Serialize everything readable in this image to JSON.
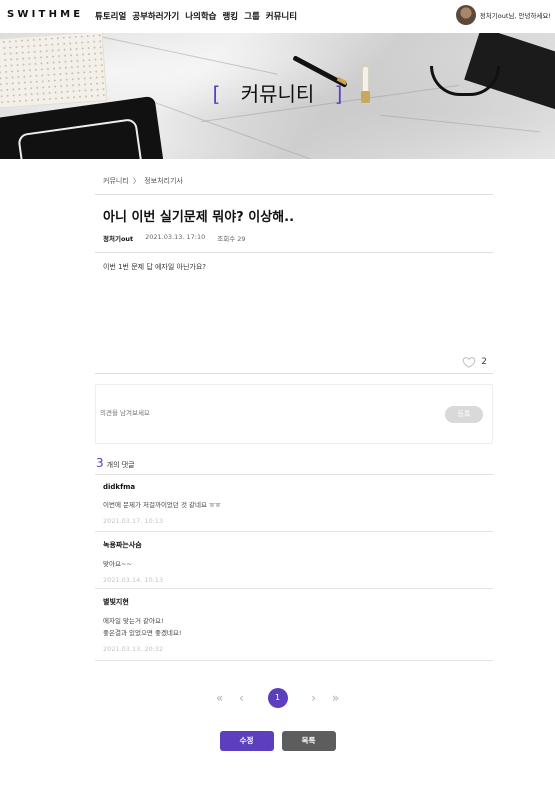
{
  "header": {
    "logo": "SWITHME",
    "nav": [
      "튜토리얼",
      "공부하러가기",
      "나의학습",
      "랭킹",
      "그룹",
      "커뮤니티"
    ],
    "greeting": "정처기out님, 안녕하세요!"
  },
  "banner": {
    "title": "커뮤니티",
    "bracket_open": "[",
    "bracket_close": "]"
  },
  "breadcrumb": {
    "root": "커뮤니티",
    "separator": "〉",
    "current": "정보처리기사"
  },
  "post": {
    "title": "아니 이번 실기문제 뭐야? 이상해..",
    "author": "정처기out",
    "date": "2021.03.13. 17:10",
    "views": "조회수 29",
    "body": "이번 1번 문제 답 에자일 아닌가요?",
    "likes": "2"
  },
  "comment_form": {
    "placeholder": "의견을 남겨보세요",
    "submit_label": "등록"
  },
  "comments_header": {
    "count": "3",
    "label": "개의 댓글"
  },
  "comments": [
    {
      "author": "didkfma",
      "lines": [
        "이번에 문제가 저걸까이었던 것 같네요 ㅠㅠ"
      ],
      "date": "2021.03.17. 10:13"
    },
    {
      "author": "녹용짜는사슴",
      "lines": [
        "맞아요~~"
      ],
      "date": "2021.03.14. 10:13"
    },
    {
      "author": "별빛지현",
      "lines": [
        "에자일 맞는거 같아요!",
        "좋은결과 있었으면 좋겠네요!"
      ],
      "date": "2021.03.13. 20:32"
    }
  ],
  "pagination": {
    "first": "«",
    "prev": "‹",
    "current": "1",
    "next": "›",
    "last": "»"
  },
  "actions": {
    "edit_label": "수정",
    "list_label": "목록"
  },
  "colors": {
    "accent": "#5b3fbd",
    "list_button": "#5d5d5d"
  },
  "icons": {
    "like": "heart-outline-icon"
  }
}
